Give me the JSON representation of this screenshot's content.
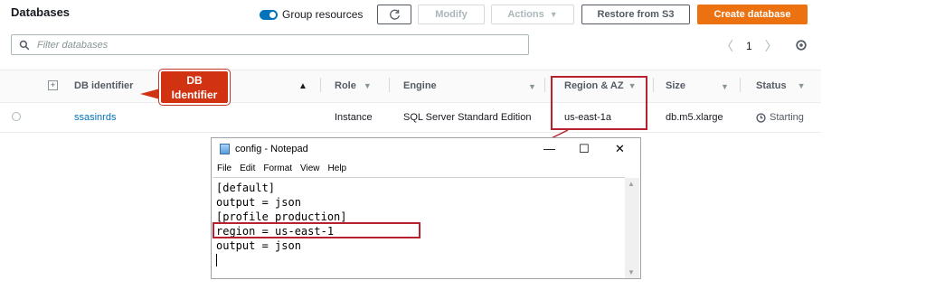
{
  "header": {
    "title": "Databases"
  },
  "toolbar": {
    "group_resources_label": "Group resources",
    "modify_label": "Modify",
    "actions_label": "Actions",
    "restore_label": "Restore from S3",
    "create_label": "Create database"
  },
  "search": {
    "placeholder": "Filter databases"
  },
  "pagination": {
    "current_page": "1"
  },
  "table": {
    "columns": {
      "db_identifier": "DB identifier",
      "role": "Role",
      "engine": "Engine",
      "region": "Region & AZ",
      "size": "Size",
      "status": "Status"
    },
    "rows": [
      {
        "db_identifier": "ssasinrds",
        "role": "Instance",
        "engine": "SQL Server Standard Edition",
        "region": "us-east-1a",
        "size": "db.m5.xlarge",
        "status": "Starting"
      }
    ]
  },
  "annotation": {
    "callout_line1": "DB",
    "callout_line2": "Identifier",
    "color": "#b7222e"
  },
  "notepad": {
    "title": "config - Notepad",
    "menu": [
      "File",
      "Edit",
      "Format",
      "View",
      "Help"
    ],
    "lines": [
      "[default]",
      "output = json",
      "[profile production]",
      "region = us-east-1",
      "output = json"
    ]
  },
  "colors": {
    "accent": "#0073bb",
    "primary_button": "#ec7211"
  }
}
